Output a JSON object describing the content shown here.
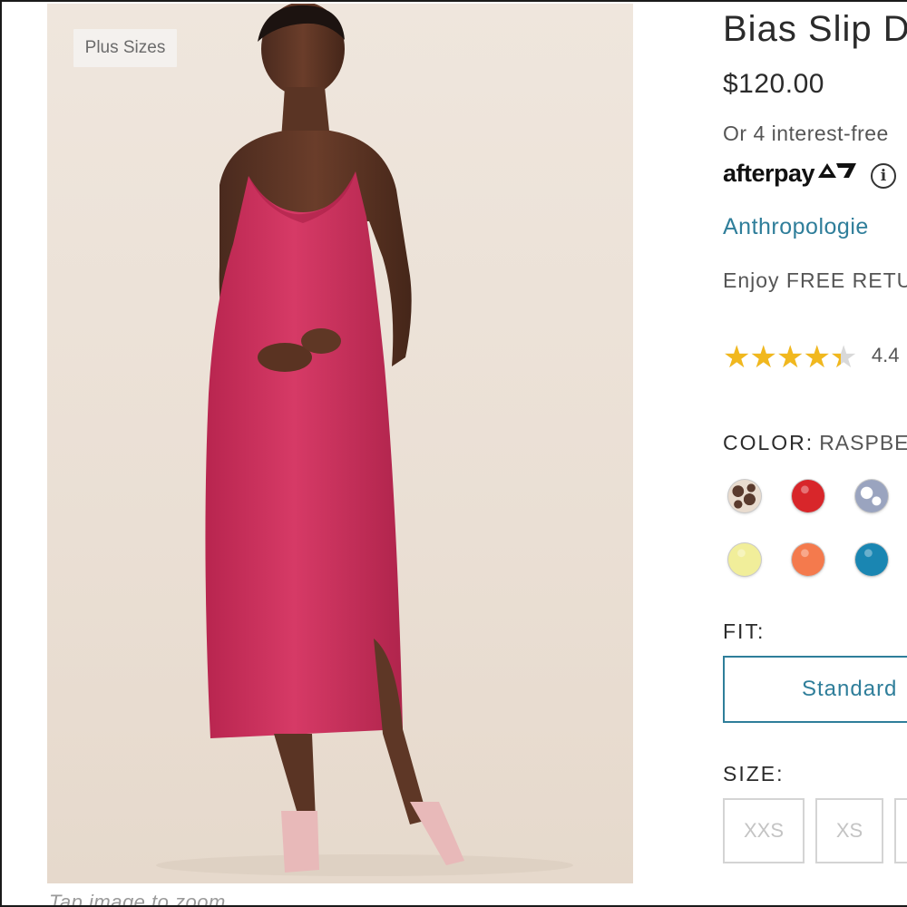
{
  "badge": {
    "label": "Plus Sizes"
  },
  "image_hint": "Tap image to zoom",
  "product": {
    "title": "Bias Slip D",
    "price": "$120.00",
    "installments_text": "Or 4 interest-free",
    "afterpay_label": "afterpay",
    "info_icon": "ⓘ",
    "brand": "Anthropologie",
    "returns_text": "Enjoy FREE RETU"
  },
  "rating": {
    "stars_glyphs": "★★★★★",
    "value": "4.4",
    "fraction": 0.88
  },
  "color": {
    "label": "COLOR:",
    "selected": "RASPBE",
    "swatches": [
      {
        "name": "leopard",
        "hex": "#5a3b2e"
      },
      {
        "name": "red",
        "hex": "#d8262a"
      },
      {
        "name": "blue-tie-dye",
        "hex": "#9aa4bf"
      },
      {
        "name": "pale-yellow",
        "hex": "#f1ee9a"
      },
      {
        "name": "orange",
        "hex": "#f47a4d"
      },
      {
        "name": "teal-blue",
        "hex": "#1a86b2"
      }
    ]
  },
  "fit": {
    "label": "FIT:",
    "selected": "Standard"
  },
  "size": {
    "label": "SIZE:",
    "options": [
      "XXS",
      "XS",
      ""
    ]
  },
  "colors": {
    "accent": "#2f7e9a",
    "star": "#f1b81e",
    "dress": "#c72e5b"
  }
}
